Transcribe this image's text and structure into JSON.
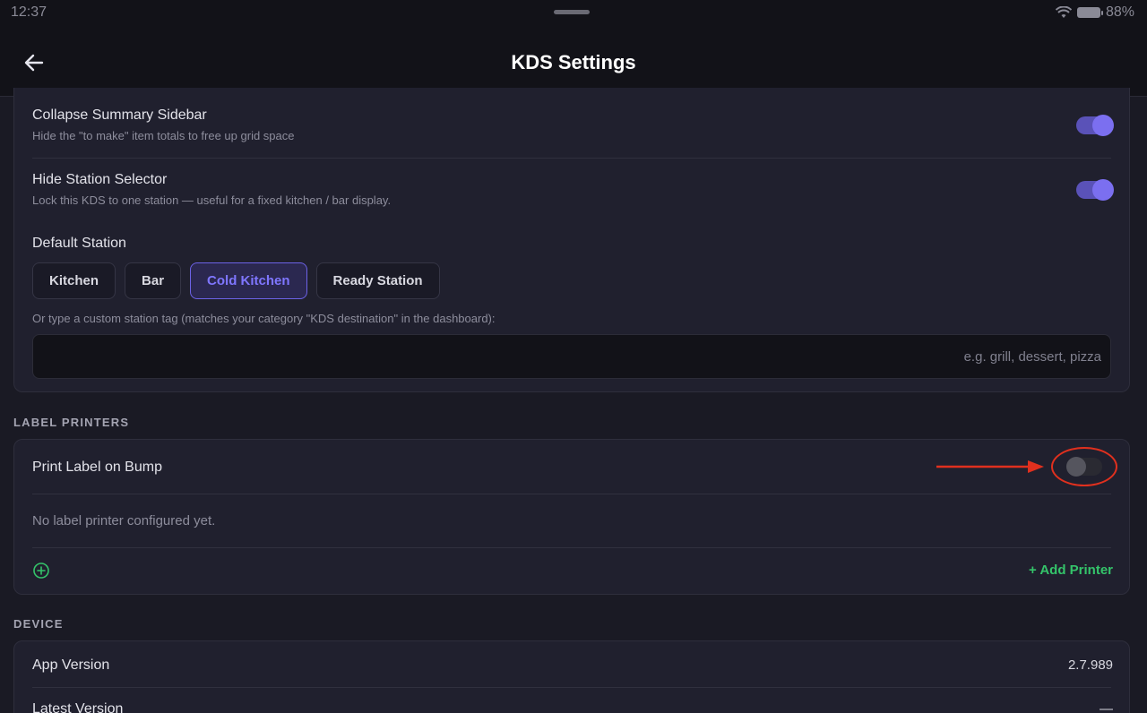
{
  "status_bar": {
    "time": "12:37",
    "battery": "88%"
  },
  "header": {
    "title": "KDS Settings"
  },
  "display": {
    "collapse_summary": {
      "title": "Collapse Summary Sidebar",
      "subtitle": "Hide the \"to make\" item totals to free up grid space",
      "enabled": true
    },
    "hide_station_selector": {
      "title": "Hide Station Selector",
      "subtitle": "Lock this KDS to one station — useful for a fixed kitchen / bar display.",
      "enabled": true
    },
    "default_station": {
      "label": "Default Station",
      "options": [
        "Kitchen",
        "Bar",
        "Cold Kitchen",
        "Ready Station"
      ],
      "selected": "Cold Kitchen",
      "custom_hint": "Or type a custom station tag (matches your category \"KDS destination\" in the dashboard):",
      "custom_value": "",
      "custom_placeholder": "e.g. grill, dessert, pizza"
    }
  },
  "label_printers": {
    "section_title": "LABEL PRINTERS",
    "print_on_bump": {
      "title": "Print Label on Bump",
      "enabled": false
    },
    "empty_text": "No label printer configured yet.",
    "add_label": "+ Add Printer"
  },
  "device": {
    "section_title": "DEVICE",
    "app_version": {
      "label": "App Version",
      "value": "2.7.989"
    },
    "latest_version": {
      "label": "Latest Version",
      "value": "—"
    }
  },
  "colors": {
    "accent": "#7b6ff0",
    "success": "#34c46a",
    "annotation": "#e0301e"
  }
}
